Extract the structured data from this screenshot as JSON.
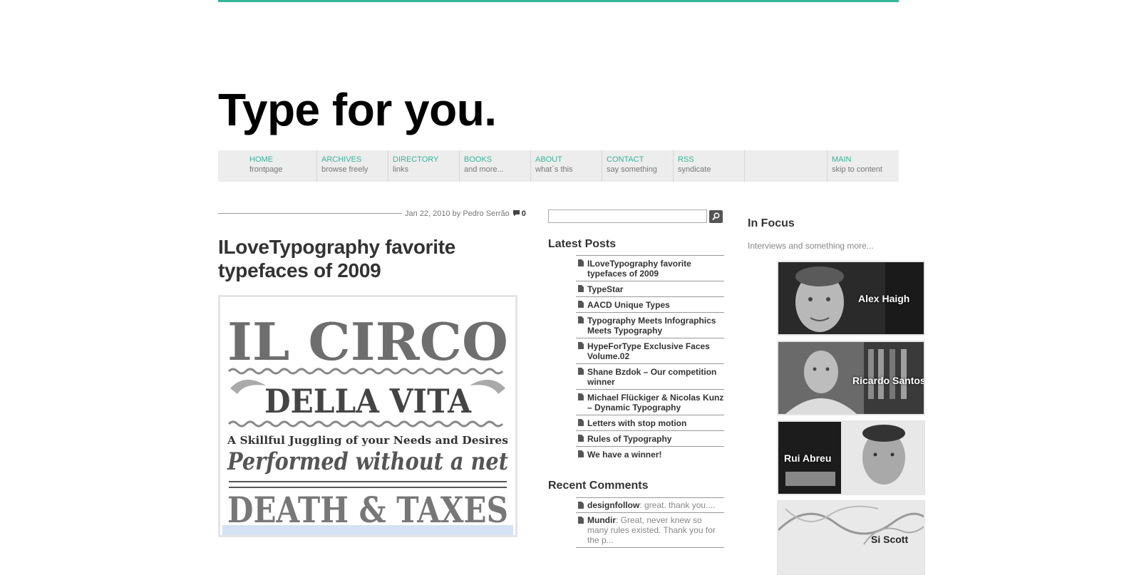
{
  "site": {
    "title": "Type for you.",
    "accent": "#34b59a"
  },
  "nav": [
    {
      "label": "HOME",
      "sub": "frontpage"
    },
    {
      "label": "ARCHIVES",
      "sub": "browse freely"
    },
    {
      "label": "DIRECTORY",
      "sub": "links"
    },
    {
      "label": "BOOKS",
      "sub": "and more..."
    },
    {
      "label": "ABOUT",
      "sub": "what´s this"
    },
    {
      "label": "CONTACT",
      "sub": "say something"
    },
    {
      "label": "RSS",
      "sub": "syndicate"
    },
    {
      "label": "MAIN",
      "sub": "skip to content"
    }
  ],
  "post": {
    "meta": "Jan 22, 2010 by Pedro Serrão",
    "comment_count": "0",
    "title": "ILoveTypography favorite typefaces of 2009",
    "image_text": {
      "line1": "IL CIRCO",
      "line2": "DELLA VITA",
      "line3": "A Skillful Juggling of your Needs and Desires",
      "line4": "Performed without a net",
      "line5": "DEATH & TAXES"
    }
  },
  "search": {
    "value": "",
    "placeholder": "",
    "icon": "search-icon"
  },
  "latest_posts": {
    "title": "Latest Posts",
    "items": [
      "ILoveTypography favorite typefaces of 2009",
      "TypeStar",
      "AACD Unique Types",
      "Typography Meets Infographics Meets Typography",
      "HypeForType Exclusive Faces Volume.02",
      "Shane Bzdok – Our competition winner",
      "Michael Flückiger & Nicolas Kunz – Dynamic Typography",
      "Letters with stop motion",
      "Rules of Typography",
      "We have a winner!"
    ]
  },
  "recent_comments": {
    "title": "Recent Comments",
    "items": [
      {
        "author": "designfollow",
        "text": ": great. thank you...."
      },
      {
        "author": "Mundir",
        "text": ": Great, never knew so many rules existed. Thank you for the p..."
      }
    ]
  },
  "in_focus": {
    "title": "In Focus",
    "subtitle": "Interviews and something more...",
    "people": [
      "Alex Haigh",
      "Ricardo Santos",
      "Rui Abreu",
      "Si Scott"
    ]
  }
}
